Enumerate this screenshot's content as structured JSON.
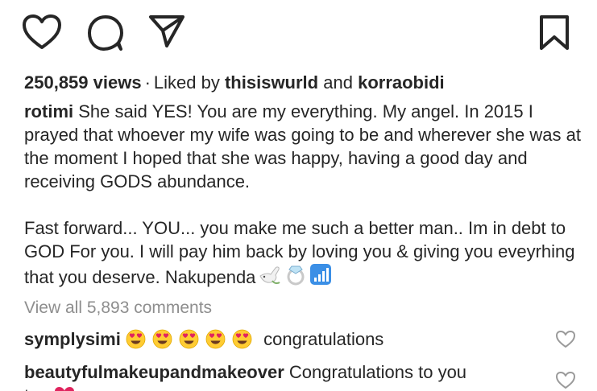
{
  "actions": {
    "like_icon": "heart-icon",
    "comment_icon": "speech-bubble-icon",
    "share_icon": "paper-plane-icon",
    "save_icon": "bookmark-icon"
  },
  "stats": {
    "views": "250,859 views",
    "separator": "·",
    "liked_by_prefix": "Liked by",
    "liked_user_1": "thisiswurld",
    "liked_conjunction": "and",
    "liked_user_2": "korraobidi"
  },
  "caption": {
    "username": "rotimi",
    "paragraph_1": "She said YES! You are my everything. My angel. In 2015 I prayed that whoever my wife was going to be and wherever she was at the moment I hoped that she was happy, having a good day and receiving GODS abundance.",
    "paragraph_2": "Fast forward... YOU... you make me such a better man.. Im in debt to GOD For you. I will pay him back by loving you & giving you eveyrhing that you deserve. Nakupenda",
    "emojis": [
      "dove-icon",
      "ring-icon",
      "signal-bars-icon"
    ]
  },
  "view_all_comments": "View all 5,893 comments",
  "comments": [
    {
      "username": "symplysimi",
      "emojis": [
        "heart-eyes-icon",
        "heart-eyes-icon",
        "heart-eyes-icon",
        "heart-eyes-icon",
        "heart-eyes-icon"
      ],
      "text": "congratulations"
    },
    {
      "username": "beautyfulmakeupandmakeover",
      "text": "Congratulations to you",
      "text_continued": "two",
      "emoji": "red-heart-icon"
    }
  ],
  "colors": {
    "text": "#262626",
    "muted": "#8e8e8e",
    "emoji_yellow": "#FFCC33",
    "heart_red": "#E0245E"
  }
}
